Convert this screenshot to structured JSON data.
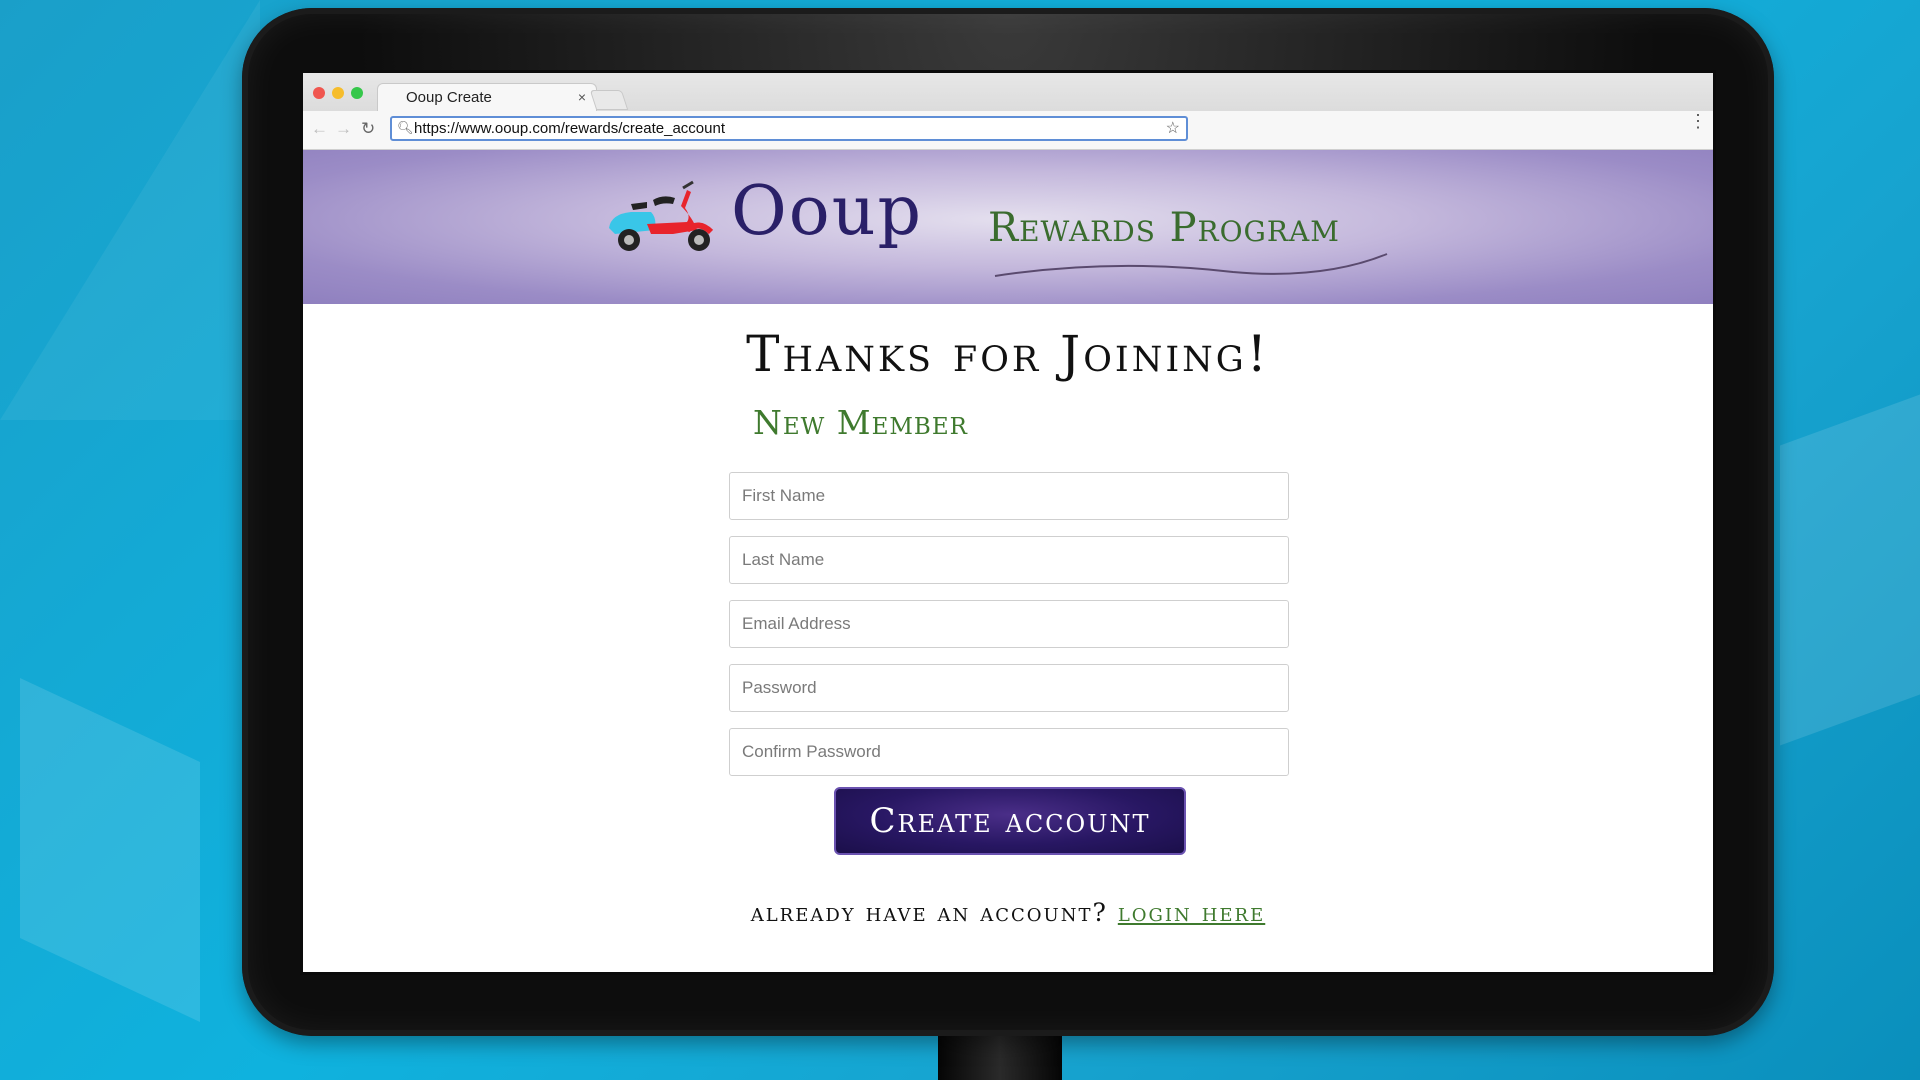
{
  "browser": {
    "tab_title": "Ooup Create",
    "tab_close": "×",
    "url": "https://www.ooup.com/rewards/create_account"
  },
  "banner": {
    "brand": "Ooup",
    "program": "Rewards Program"
  },
  "page": {
    "heading": "Thanks for Joining!",
    "subheading": "New Member"
  },
  "form": {
    "first_name_placeholder": "First Name",
    "last_name_placeholder": "Last Name",
    "email_placeholder": "Email Address",
    "password_placeholder": "Password",
    "confirm_password_placeholder": "Confirm Password",
    "submit_label": "Create account"
  },
  "footer": {
    "prompt": "already have an account?",
    "login_label": "login here"
  },
  "colors": {
    "brand_purple": "#2a2068",
    "accent_green": "#3f7a2e",
    "button_purple": "#281763"
  },
  "icons": [
    "back-arrow-icon",
    "forward-arrow-icon",
    "reload-icon",
    "search-icon",
    "star-icon",
    "menu-dots-icon",
    "scooter-logo-icon"
  ]
}
